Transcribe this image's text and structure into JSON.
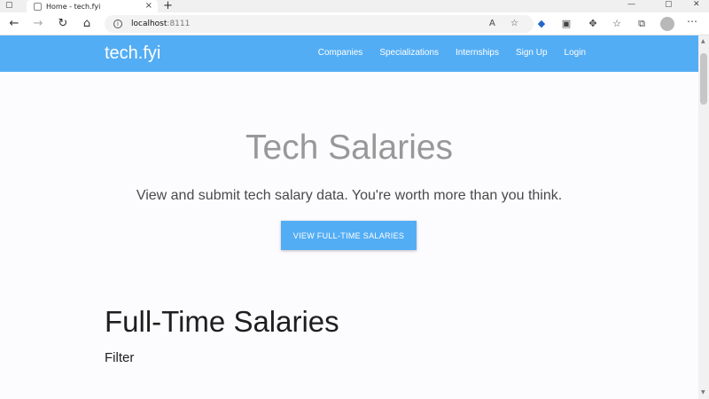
{
  "browser": {
    "tab_title": "Home - tech.fyi",
    "new_tab": "+",
    "tab_close": "×",
    "url_host": "localhost",
    "url_port": ":8111"
  },
  "site": {
    "brand": "tech.fyi",
    "nav": [
      "Companies",
      "Specializations",
      "Internships",
      "Sign Up",
      "Login"
    ]
  },
  "hero": {
    "title": "Tech Salaries",
    "subtitle": "View and submit tech salary data. You're worth more than you think.",
    "button": "VIEW FULL-TIME SALARIES"
  },
  "section": {
    "title": "Full-Time Salaries",
    "filter": "Filter"
  },
  "colors": {
    "primary": "#53adf4",
    "page_bg": "#fcfbfe"
  }
}
